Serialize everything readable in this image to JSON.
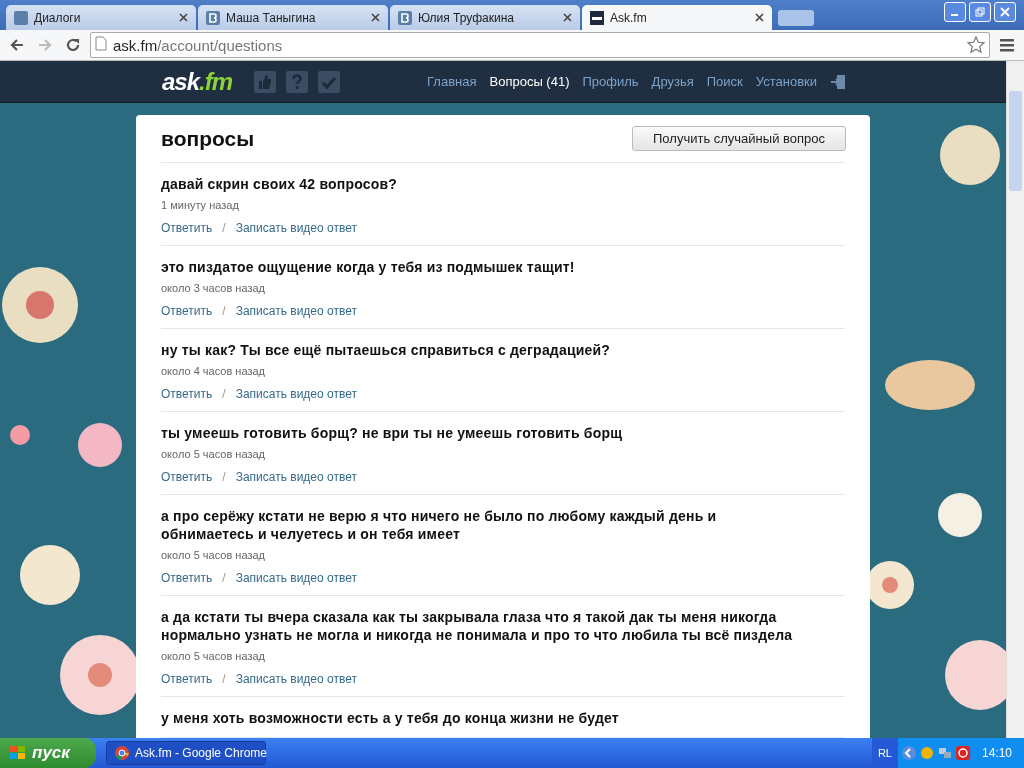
{
  "browser": {
    "tabs": [
      {
        "title": "Диалоги",
        "kind": "chat",
        "selected": false
      },
      {
        "title": "Маша Таныгина",
        "kind": "vk",
        "selected": false
      },
      {
        "title": "Юлия Труфакина",
        "kind": "vk",
        "selected": false
      },
      {
        "title": "Ask.fm",
        "kind": "ask",
        "selected": true
      }
    ],
    "address_host": "ask.fm",
    "address_path": "/account/questions"
  },
  "site": {
    "logo_main": "ask",
    "logo_suffix": ".fm",
    "nav": [
      {
        "label": "Главная",
        "selected": false
      },
      {
        "label": "Вопросы (41)",
        "selected": true
      },
      {
        "label": "Профиль",
        "selected": false
      },
      {
        "label": "Друзья",
        "selected": false
      },
      {
        "label": "Поиск",
        "selected": false
      },
      {
        "label": "Установки",
        "selected": false
      }
    ]
  },
  "page": {
    "title": "вопросы",
    "random_button": "Получить случайный вопрос",
    "questions": [
      {
        "text": "давай скрин своих 42 вопросов?",
        "time": "1 минуту назад",
        "answer": "Ответить",
        "separator": "/",
        "video": "Записать видео ответ"
      },
      {
        "text": "это пиздатое ощущение когда у тебя из подмышек тащит!",
        "time": "около 3 часов назад",
        "answer": "Ответить",
        "separator": "/",
        "video": "Записать видео ответ"
      },
      {
        "text": "ну ты как? Ты все ещё пытаешься справиться с деградацией?",
        "time": "около 4 часов назад",
        "answer": "Ответить",
        "separator": "/",
        "video": "Записать видео ответ"
      },
      {
        "text": "ты умеешь готовить борщ? не ври ты не умеешь готовить борщ",
        "time": "около 5 часов назад",
        "answer": "Ответить",
        "separator": "/",
        "video": "Записать видео ответ"
      },
      {
        "text": "а про серёжу кстати не верю я что ничего не было по любому каждый день и обнимаетесь и челуетесь и он тебя имеет",
        "time": "около 5 часов назад",
        "answer": "Ответить",
        "separator": "/",
        "video": "Записать видео ответ"
      },
      {
        "text": "а да кстати ты вчера сказала как ты закрывала глаза что я такой дак ты меня никогда нормально узнать не могла и никогда не понимала и про то что любила ты всё пиздела",
        "time": "около 5 часов назад",
        "answer": "Ответить",
        "separator": "/",
        "video": "Записать видео ответ"
      },
      {
        "text": "у меня хоть возможности есть а у тебя до конца жизни не будет"
      }
    ]
  },
  "taskbar": {
    "start": "пуск",
    "task": "Ask.fm - Google Chrome",
    "language": "RL",
    "clock": "14:10"
  }
}
